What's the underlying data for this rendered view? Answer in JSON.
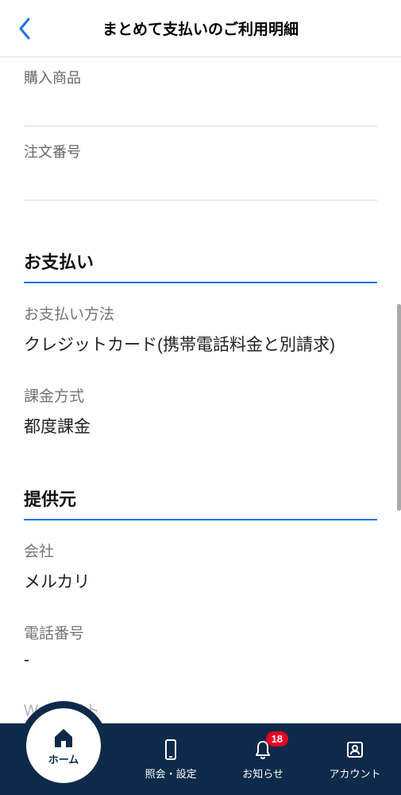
{
  "header": {
    "title": "まとめて支払いのご利用明細"
  },
  "top_fields": {
    "item_label": "購入商品",
    "order_label": "注文番号"
  },
  "payment": {
    "section_title": "お支払い",
    "method_label": "お支払い方法",
    "method_value": "クレジットカード(携帯電話料金と別請求)",
    "billing_label": "課金方式",
    "billing_value": "都度課金"
  },
  "provider": {
    "section_title": "提供元",
    "company_label": "会社",
    "company_value": "メルカリ",
    "phone_label": "電話番号",
    "phone_value": "-",
    "website_label": "Webサイト"
  },
  "nav": {
    "home": "ホーム",
    "inquiry": "照会・設定",
    "notice": "お知らせ",
    "account": "アカウント",
    "badge": "18"
  },
  "colors": {
    "accent": "#1a73e8",
    "nav_bg": "#0d2a4a",
    "badge": "#e60023"
  }
}
